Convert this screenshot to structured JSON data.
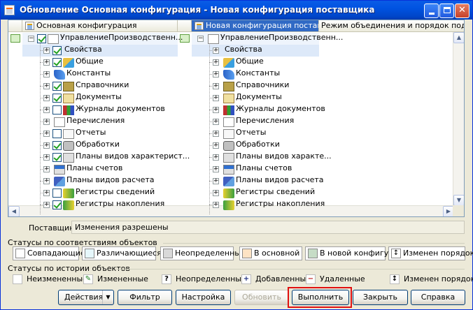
{
  "window": {
    "title": "Обновление Основная конфигурация - Новая конфигурация поставщика"
  },
  "grid": {
    "columns": [
      {
        "label": "Основная конфигурация"
      },
      {
        "label": "Новая конфигурация постав..."
      },
      {
        "label": "Режим объединения и порядок подчин"
      }
    ],
    "left_rows": [
      {
        "label": "УправлениеПроизводственн...",
        "checked": true,
        "icon": "config-icon"
      },
      {
        "label": "Свойства",
        "checked": true,
        "icon": "none"
      },
      {
        "label": "Общие",
        "checked": true,
        "icon": "common-icon"
      },
      {
        "label": "Константы",
        "checked": null,
        "icon": "constants-icon"
      },
      {
        "label": "Справочники",
        "checked": true,
        "icon": "catalogs-icon"
      },
      {
        "label": "Документы",
        "checked": true,
        "icon": "documents-icon"
      },
      {
        "label": "Журналы документов",
        "checked": false,
        "icon": "journals-icon"
      },
      {
        "label": "Перечисления",
        "checked": null,
        "icon": "enums-icon"
      },
      {
        "label": "Отчеты",
        "checked": false,
        "icon": "reports-icon"
      },
      {
        "label": "Обработки",
        "checked": true,
        "icon": "processing-icon"
      },
      {
        "label": "Планы видов характерист...",
        "checked": true,
        "icon": "chart-types-icon"
      },
      {
        "label": "Планы счетов",
        "checked": null,
        "icon": "accounts-icon"
      },
      {
        "label": "Планы видов расчета",
        "checked": null,
        "icon": "calc-types-icon"
      },
      {
        "label": "Регистры сведений",
        "checked": false,
        "icon": "info-registers-icon"
      },
      {
        "label": "Регистры накопления",
        "checked": true,
        "icon": "accum-registers-icon"
      }
    ],
    "right_rows": [
      {
        "label": "УправлениеПроизводственн..."
      },
      {
        "label": "Свойства"
      },
      {
        "label": "Общие"
      },
      {
        "label": "Константы"
      },
      {
        "label": "Справочники"
      },
      {
        "label": "Документы"
      },
      {
        "label": "Журналы документов"
      },
      {
        "label": "Перечисления"
      },
      {
        "label": "Отчеты"
      },
      {
        "label": "Обработки"
      },
      {
        "label": "Планы видов характе..."
      },
      {
        "label": "Планы счетов"
      },
      {
        "label": "Планы видов расчета"
      },
      {
        "label": "Регистры сведений"
      },
      {
        "label": "Регистры накопления"
      }
    ]
  },
  "supplier": {
    "label": "Поставщик:",
    "value": "Изменения разрешены"
  },
  "statuses_match": {
    "title": "Статусы по соответствиям объектов",
    "items": [
      {
        "label": "Совпадающие",
        "color": "#ffffff"
      },
      {
        "label": "Различающиеся",
        "color": "#e6f7fb"
      },
      {
        "label": "Неопределенные",
        "color": "#d9d9d9"
      },
      {
        "label": "В основной",
        "color": "#fde3c4"
      },
      {
        "label": "В новой конфигу...",
        "color": "#c6dcc6"
      },
      {
        "label": "Изменен порядок",
        "color": "#ffffff"
      }
    ]
  },
  "statuses_history": {
    "title": "Статусы по истории объектов",
    "items": [
      {
        "label": "Неизмененные",
        "glyph": ""
      },
      {
        "label": "Измененные",
        "glyph": "✎"
      },
      {
        "label": "Неопределенные",
        "glyph": "?"
      },
      {
        "label": "Добавленные",
        "glyph": "+"
      },
      {
        "label": "Удаленные",
        "glyph": "−"
      },
      {
        "label": "Изменен порядок",
        "glyph": "↕"
      }
    ]
  },
  "buttons": {
    "actions": "Действия",
    "filter": "Фильтр",
    "settings": "Настройка",
    "update": "Обновить",
    "execute": "Выполнить",
    "close": "Закрыть",
    "help": "Справка"
  }
}
